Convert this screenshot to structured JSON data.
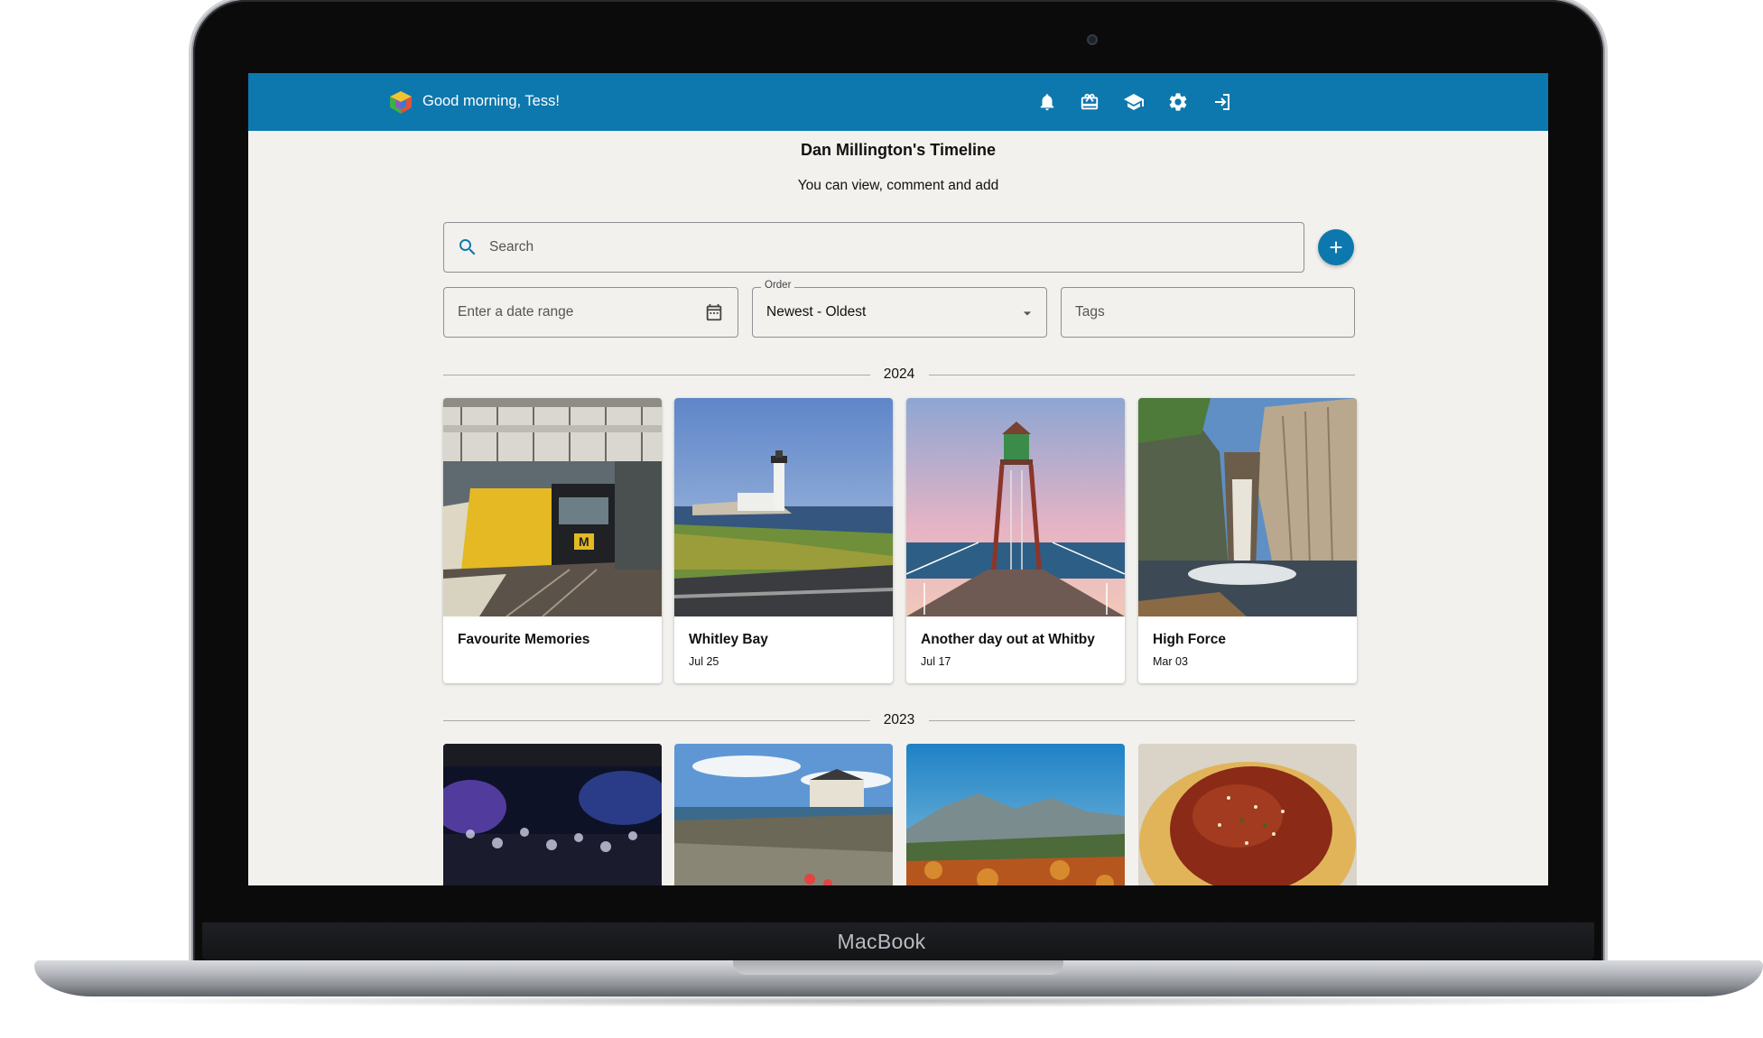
{
  "device": {
    "brand": "MacBook"
  },
  "header": {
    "greeting": "Good morning, Tess!",
    "icons": [
      "bell-icon",
      "gift-icon",
      "graduation-cap-icon",
      "gear-icon",
      "logout-icon"
    ]
  },
  "page": {
    "title": "Dan Millington's Timeline",
    "subtitle": "You can view, comment and add"
  },
  "filters": {
    "search_placeholder": "Search",
    "date_range_placeholder": "Enter a date range",
    "order_label": "Order",
    "order_value": "Newest - Oldest",
    "tags_placeholder": "Tags"
  },
  "sections": [
    {
      "year": "2024",
      "cards": [
        {
          "title": "Favourite Memories",
          "date": ""
        },
        {
          "title": "Whitley Bay",
          "date": "Jul 25"
        },
        {
          "title": "Another day out at Whitby",
          "date": "Jul 17"
        },
        {
          "title": "High Force",
          "date": "Mar 03"
        }
      ]
    },
    {
      "year": "2023",
      "cards": [
        {
          "title": "",
          "date": ""
        },
        {
          "title": "",
          "date": ""
        },
        {
          "title": "",
          "date": ""
        },
        {
          "title": "",
          "date": ""
        }
      ]
    }
  ],
  "colors": {
    "primary": "#0d78ad",
    "background": "#f2f1ed",
    "card": "#ffffff"
  }
}
